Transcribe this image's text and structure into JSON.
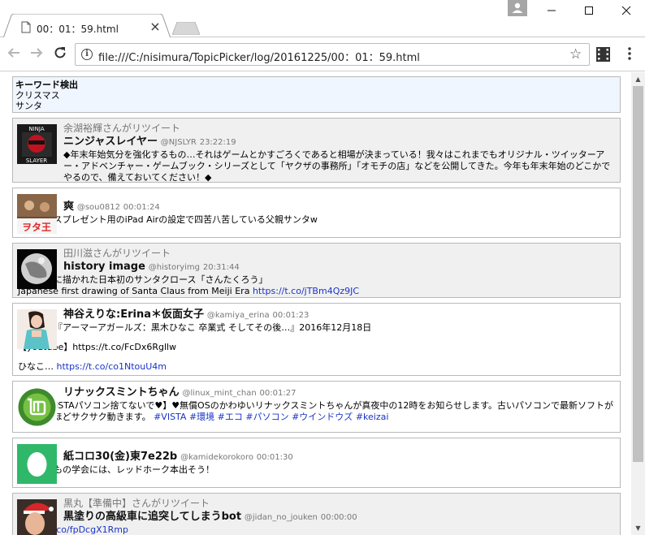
{
  "browser": {
    "tab_title": "00：01：59.html",
    "url": "file:///C:/nisimura/TopicPicker/log/20161225/00：01：59.html"
  },
  "keywords": {
    "title": "キーワード検出",
    "items": [
      "クリスマス",
      "サンタ"
    ]
  },
  "tweets": [
    {
      "retweet": "余湖裕輝さんがリツイート",
      "name": "ニンジャスレイヤー",
      "screen": "@NJSLYR",
      "time": "23:22:19",
      "text": "◆年末年始気分を強化するもの…それはゲームとかすごろくであると相場が決まっている！我々はこれまでもオリジナル・ツイッターアー・アドベンチャー・ゲームブック・シリーズとして「ヤクザの事務所」「オモチの店」などを公開してきた。今年も年末年始のどこかでやるので、備えておいてください！◆",
      "avatar_colors": [
        "#1a1a1a",
        "#c1121f"
      ]
    },
    {
      "retweet": "",
      "name": "爽",
      "screen": "@sou0812",
      "time": "00:01:24",
      "text": "クリスマスプレゼント用のiPad Airの設定で四苦八苦している父親サンタw",
      "avatar_colors": [
        "#5a3b2a",
        "#e23a3a"
      ]
    },
    {
      "retweet": "田川滋さんがリツイート",
      "name": "history image",
      "screen": "@historyimg",
      "time": "20:31:44",
      "text": "明治時代に描かれた日本初のサンタクロース「さんたくろう」",
      "text2": "Japanese first drawing of Santa Claus from Meiji Era",
      "link": "https://t.co/jTBm4Qz9JC",
      "avatar_colors": [
        "#0b0b0b",
        "#d9d9d9"
      ]
    },
    {
      "retweet": "",
      "name": "神谷えりな:Erina＊仮面女子",
      "screen": "@kamiya_erina",
      "time": "00:01:23",
      "text": "仮面女子『アーマーアガールズ：黒木ひなこ 卒業式 そしてその後…』2016年12月18日",
      "text2": "【youtube】https://t.co/FcDx6Rgllw",
      "text3": "ひなこ…",
      "link": "https://t.co/co1NtouU4m",
      "avatar_colors": [
        "#f1e4dc",
        "#5bc2c8"
      ]
    },
    {
      "retweet": "",
      "name": "リナックスミントちゃん",
      "screen": "@linux_mint_chan",
      "time": "00:01:27",
      "text": "【♥XP VISTAパソコン捨てないで♥】♥無償OSのかわゆいリナックスミントちゃんが真夜中の12時をお知らせします。古いパソコンで最新ソフトが見違えるほどサクサク動きます。",
      "tags": [
        "#VISTA",
        "#環境",
        "#エコ",
        "#パソコン",
        "#ウインドウズ",
        "#keizai"
      ],
      "avatar_colors": [
        "#3e8a2c",
        "#ffffff"
      ]
    },
    {
      "retweet": "",
      "name": "紙コロ30(金)東7e22b",
      "screen": "@kamidekorokoro",
      "time": "00:01:30",
      "text": "春のとびもの学会には、レッドホーク本出そう！",
      "avatar_colors": [
        "#2fb86a",
        "#ffffff"
      ]
    },
    {
      "retweet": "黒丸【準備中】さんがリツイート",
      "name": "黒塗りの高級車に追突してしまうbot",
      "screen": "@jidan_no_jouken",
      "time": "00:00:00",
      "link": "https://t.co/fpDcgX1Rmp",
      "avatar_colors": [
        "#c92a2a",
        "#e8b596"
      ]
    }
  ]
}
